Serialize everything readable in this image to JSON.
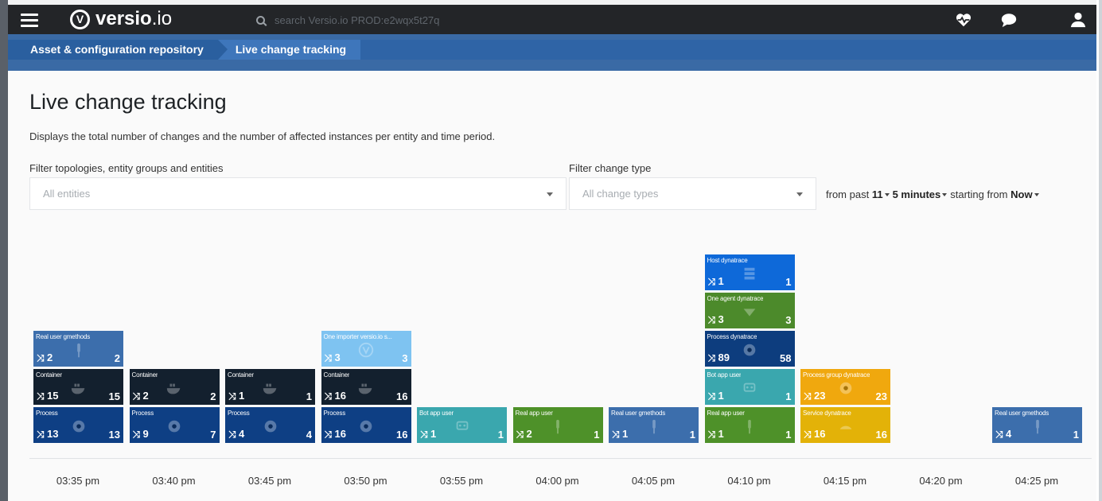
{
  "app": {
    "name_bold": "versio",
    "name_light": ".io",
    "search_placeholder": "search Versio.io PROD:e2wqx5t27q"
  },
  "breadcrumb": {
    "items": [
      "Asset & configuration repository",
      "Live change tracking"
    ]
  },
  "page": {
    "title": "Live change tracking",
    "description": "Displays the total number of changes and the number of affected instances per entity and time period."
  },
  "filters": {
    "entities_label": "Filter topologies, entity groups and entities",
    "entities_placeholder": "All entities",
    "change_type_label": "Filter change type",
    "change_type_placeholder": "All change types",
    "period_prefix": "from past",
    "period_count": "11",
    "period_unit": "5 minutes",
    "period_mid": "starting from",
    "period_start": "Now"
  },
  "colors": {
    "process": "#0e3f84",
    "container": "#13202e",
    "real_user_gmethods": "#3c6eac",
    "one_importer": "#7ec3f1",
    "bot_app_user": "#3aa7ae",
    "real_app_user": "#4e9129",
    "host": "#0e69d9",
    "one_agent": "#4c8a2b",
    "process_dynatrace": "#0d3d7e",
    "process_group": "#f0a80e",
    "service": "#e3b208"
  },
  "timeline": {
    "labels": [
      "03:35 pm",
      "03:40 pm",
      "03:45 pm",
      "03:50 pm",
      "03:55 pm",
      "04:00 pm",
      "04:05 pm",
      "04:10 pm",
      "04:15 pm",
      "04:20 pm",
      "04:25 pm"
    ],
    "columns": [
      [
        {
          "name": "Process",
          "changes": "13",
          "instances": "13",
          "color": "process",
          "icon": "gear-icon"
        },
        {
          "name": "Container",
          "changes": "15",
          "instances": "15",
          "color": "container",
          "icon": "docker-icon"
        },
        {
          "name": "Real user gmethods",
          "changes": "2",
          "instances": "2",
          "color": "real_user_gmethods",
          "icon": "user-icon"
        }
      ],
      [
        {
          "name": "Process",
          "changes": "9",
          "instances": "7",
          "color": "process",
          "icon": "gear-icon"
        },
        {
          "name": "Container",
          "changes": "2",
          "instances": "2",
          "color": "container",
          "icon": "docker-icon"
        }
      ],
      [
        {
          "name": "Process",
          "changes": "4",
          "instances": "4",
          "color": "process",
          "icon": "gear-icon"
        },
        {
          "name": "Container",
          "changes": "1",
          "instances": "1",
          "color": "container",
          "icon": "docker-icon"
        }
      ],
      [
        {
          "name": "Process",
          "changes": "16",
          "instances": "16",
          "color": "process",
          "icon": "gear-icon"
        },
        {
          "name": "Container",
          "changes": "16",
          "instances": "16",
          "color": "container",
          "icon": "docker-icon"
        },
        {
          "name": "One importer versio.io s...",
          "changes": "3",
          "instances": "3",
          "color": "one_importer",
          "icon": "versio-icon"
        }
      ],
      [
        {
          "name": "Bot app user",
          "changes": "1",
          "instances": "1",
          "color": "bot_app_user",
          "icon": "robot-icon"
        }
      ],
      [
        {
          "name": "Real app user",
          "changes": "2",
          "instances": "1",
          "color": "real_app_user",
          "icon": "user-icon"
        }
      ],
      [
        {
          "name": "Real user gmethods",
          "changes": "1",
          "instances": "1",
          "color": "real_user_gmethods",
          "icon": "user-icon"
        }
      ],
      [
        {
          "name": "Real app user",
          "changes": "1",
          "instances": "1",
          "color": "real_app_user",
          "icon": "user-icon"
        },
        {
          "name": "Bot app user",
          "changes": "1",
          "instances": "1",
          "color": "bot_app_user",
          "icon": "robot-icon"
        },
        {
          "name": "Process dynatrace",
          "changes": "89",
          "instances": "58",
          "color": "process_dynatrace",
          "icon": "gear-icon"
        },
        {
          "name": "One agent dynatrace",
          "changes": "3",
          "instances": "3",
          "color": "one_agent",
          "icon": "agent-icon"
        },
        {
          "name": "Host dynatrace",
          "changes": "1",
          "instances": "1",
          "color": "host",
          "icon": "server-icon"
        }
      ],
      [
        {
          "name": "Service dynatrace",
          "changes": "16",
          "instances": "16",
          "color": "service",
          "icon": "service-icon"
        },
        {
          "name": "Process group dynatrace",
          "changes": "23",
          "instances": "23",
          "color": "process_group",
          "icon": "gear-icon"
        }
      ],
      [],
      [
        {
          "name": "Real user gmethods",
          "changes": "4",
          "instances": "1",
          "color": "real_user_gmethods",
          "icon": "user-icon"
        }
      ]
    ]
  }
}
